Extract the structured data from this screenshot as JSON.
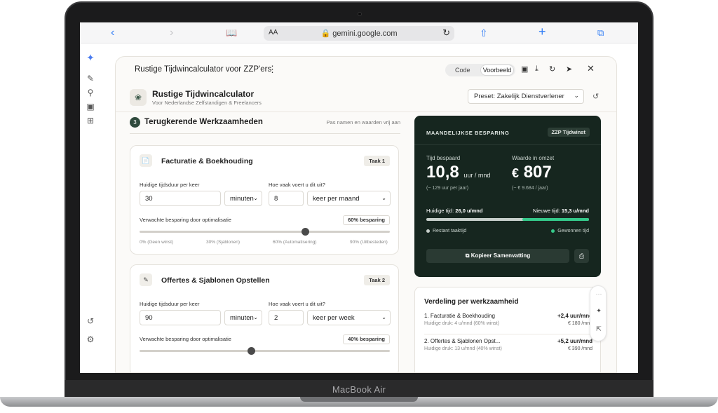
{
  "device": {
    "brand": "MacBook Air"
  },
  "browser": {
    "aa": "AA",
    "url": "gemini.google.com"
  },
  "canvas": {
    "title": "Rustige Tijdwincalculator voor ZZP'ers",
    "toggle": {
      "code": "Code",
      "preview": "Voorbeeld"
    }
  },
  "app": {
    "title": "Rustige Tijdwincalculator",
    "subtitle": "Voor Nederlandse Zelfstandigen & Freelancers",
    "preset": "Preset: Zakelijk Dienstverlener"
  },
  "section": {
    "number": "3",
    "title": "Terugkerende Werkzaamheden",
    "hint": "Pas namen en waarden vrij aan"
  },
  "tasks": [
    {
      "title": "Facturatie & Boekhouding",
      "badge": "Taak 1",
      "duration_label": "Huidige tijdsduur per keer",
      "duration": "30",
      "unit": "minuten",
      "freq_label": "Hoe vaak voert u dit uit?",
      "freq": "8",
      "period": "keer per maand",
      "saving_label": "Verwachte besparing door optimalisatie",
      "saving_badge": "60% besparing",
      "saving_fraction": 0.6,
      "ticks": [
        "0% (Geen winst)",
        "30% (Sjablonen)",
        "60% (Automatisering)",
        "90% (Uitbesteden)"
      ]
    },
    {
      "title": "Offertes & Sjablonen Opstellen",
      "badge": "Taak 2",
      "duration_label": "Huidige tijdsduur per keer",
      "duration": "90",
      "unit": "minuten",
      "freq_label": "Hoe vaak voert u dit uit?",
      "freq": "2",
      "period": "keer per week",
      "saving_label": "Verwachte besparing door optimalisatie",
      "saving_badge": "40% besparing",
      "saving_fraction": 0.4
    }
  ],
  "summary": {
    "heading": "MAANDELIJKSE BESPARING",
    "badge": "ZZP Tijdwinst",
    "saved_label": "Tijd bespaard",
    "saved_value": "10,8",
    "saved_unit": "uur / mnd",
    "saved_year": "(~ 129 uur per jaar)",
    "value_label": "Waarde in omzet",
    "value_currency": "€",
    "value": "807",
    "value_year": "(~ € 9.684 / jaar)",
    "current_label": "Huidige tijd:",
    "current": "26,0 u/mnd",
    "new_label": "Nieuwe tijd:",
    "new": "15,3 u/mnd",
    "remaining_fraction": 0.59,
    "legend_remaining": "Restant taaktijd",
    "legend_gained": "Gewonnen tijd",
    "copy_button": "Kopieer Samenvatting",
    "colors": {
      "gained": "#35c98a",
      "remaining": "#c7cfcb"
    }
  },
  "breakdown": {
    "title": "Verdeling per werkzaamheid",
    "items": [
      {
        "name": "1. Facturatie & Boekhouding",
        "detail": "Huidige druk: 4 u/mnd (60% winst)",
        "gain": "+2,4 uur/mnd",
        "euro": "€ 180 /mnd"
      },
      {
        "name": "2. Offertes & Sjablonen Opst...",
        "detail": "Huidige druk: 13 u/mnd (40% winst)",
        "gain": "+5,2 uur/mnd",
        "euro": "€ 390 /mnd"
      }
    ]
  }
}
